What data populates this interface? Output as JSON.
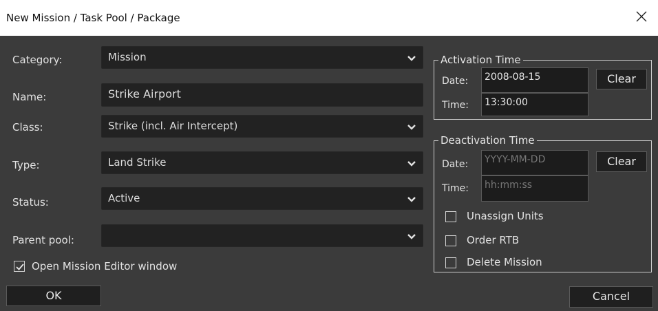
{
  "window": {
    "title": "New Mission / Task Pool / Package"
  },
  "form": {
    "category": {
      "label": "Category:",
      "value": "Mission"
    },
    "name": {
      "label": "Name:",
      "value": "Strike Airport"
    },
    "class": {
      "label": "Class:",
      "value": "Strike (incl. Air Intercept)"
    },
    "type": {
      "label": "Type:",
      "value": "Land Strike"
    },
    "status": {
      "label": "Status:",
      "value": "Active"
    },
    "parent_pool": {
      "label": "Parent pool:",
      "value": ""
    }
  },
  "open_editor": {
    "label": "Open Mission Editor window",
    "checked": true
  },
  "activation": {
    "legend": "Activation Time",
    "date_label": "Date:",
    "date_value": "2008-08-15",
    "time_label": "Time:",
    "time_value": "13:30:00",
    "clear_label": "Clear"
  },
  "deactivation": {
    "legend": "Deactivation Time",
    "date_label": "Date:",
    "date_placeholder": "YYYY-MM-DD",
    "time_label": "Time:",
    "time_placeholder": "hh:mm:ss",
    "clear_label": "Clear",
    "options": [
      {
        "label": "Unassign Units",
        "checked": false
      },
      {
        "label": "Order RTB",
        "checked": false
      },
      {
        "label": "Delete Mission",
        "checked": false
      }
    ]
  },
  "buttons": {
    "ok": "OK",
    "cancel": "Cancel"
  },
  "colors": {
    "background": "#3b3b3b",
    "field": "#222222",
    "text": "#e2e2e2"
  }
}
